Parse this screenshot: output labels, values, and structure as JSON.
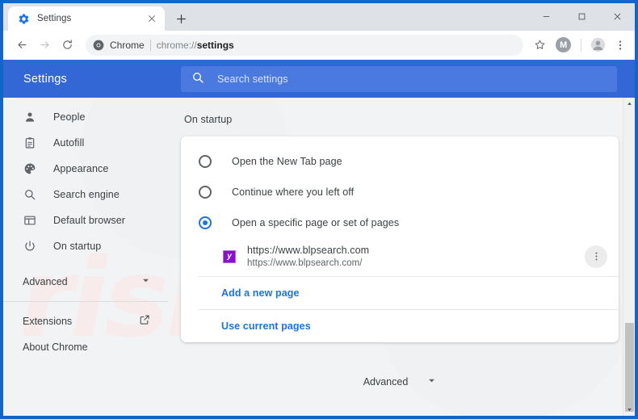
{
  "window": {
    "frame_color": "#1266c9",
    "controls": [
      {
        "name": "minimize-button",
        "glyph": "–"
      },
      {
        "name": "maximize-button",
        "glyph": "□"
      },
      {
        "name": "close-button",
        "glyph": "✕"
      }
    ]
  },
  "tabstrip": {
    "tab": {
      "title": "Settings",
      "favicon": "settings-gear-icon",
      "close_glyph": "✕"
    },
    "new_tab_glyph": "+",
    "new_tab_label": "New tab"
  },
  "toolbar": {
    "back_label": "Back",
    "forward_label": "Forward",
    "reload_label": "Reload",
    "omnibox": {
      "chip_label": "Chrome",
      "chip_icon": "chrome-logo-icon",
      "url_prefix": "chrome://",
      "url_bold": "settings",
      "full_url": "chrome://settings"
    },
    "star_label": "Bookmark this page",
    "extension_avatar_letter": "M",
    "profile_label": "Profile",
    "menu_glyph": "⋮"
  },
  "settings_header": {
    "title": "Settings",
    "search": {
      "placeholder": "Search settings",
      "value": "",
      "icon": "search-icon"
    },
    "background": "#3367d6"
  },
  "sidebar": {
    "items": [
      {
        "label": "People",
        "icon": "person-icon"
      },
      {
        "label": "Autofill",
        "icon": "clipboard-icon"
      },
      {
        "label": "Appearance",
        "icon": "palette-icon"
      },
      {
        "label": "Search engine",
        "icon": "search-icon"
      },
      {
        "label": "Default browser",
        "icon": "browser-window-icon"
      },
      {
        "label": "On startup",
        "icon": "power-icon"
      }
    ],
    "advanced": {
      "label": "Advanced",
      "icon": "chevron-down-icon"
    },
    "links": [
      {
        "label": "Extensions",
        "icon": "open-in-new-icon"
      },
      {
        "label": "About Chrome",
        "icon": ""
      }
    ]
  },
  "main": {
    "heading": "On startup",
    "options": [
      {
        "label": "Open the New Tab page",
        "selected": false
      },
      {
        "label": "Continue where you left off",
        "selected": false
      },
      {
        "label": "Open a specific page or set of pages",
        "selected": true
      }
    ],
    "startup_page": {
      "title": "https://www.blpsearch.com",
      "url": "https://www.blpsearch.com/",
      "favicon_glyph": "y",
      "favicon_color": "#8b11c9",
      "menu_glyph": "⋮"
    },
    "links": [
      {
        "label": "Add a new page"
      },
      {
        "label": "Use current pages"
      }
    ],
    "link_color": "#1a73e8",
    "advanced_bottom": {
      "label": "Advanced",
      "icon": "chevron-down-icon"
    }
  },
  "watermark": {
    "text": "risk.com"
  },
  "scrollbar": {
    "up_glyph": "▲",
    "down_glyph": "▼"
  }
}
